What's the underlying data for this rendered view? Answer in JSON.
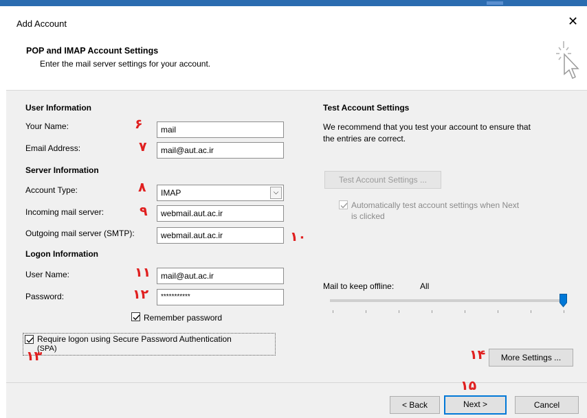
{
  "window": {
    "title": "Add Account",
    "close_glyph": "✕"
  },
  "header": {
    "title": "POP and IMAP Account Settings",
    "subtitle": "Enter the mail server settings for your account."
  },
  "user_info": {
    "heading": "User Information",
    "name_label": "Your Name:",
    "name_value": "mail",
    "email_label": "Email Address:",
    "email_value": "mail@aut.ac.ir"
  },
  "server_info": {
    "heading": "Server Information",
    "account_type_label": "Account Type:",
    "account_type_value": "IMAP",
    "incoming_label": "Incoming mail server:",
    "incoming_value": "webmail.aut.ac.ir",
    "outgoing_label": "Outgoing mail server (SMTP):",
    "outgoing_value": "webmail.aut.ac.ir"
  },
  "logon_info": {
    "heading": "Logon Information",
    "username_label": "User Name:",
    "username_value": "mail@aut.ac.ir",
    "password_label": "Password:",
    "password_value": "***********",
    "remember_label": "Remember password",
    "remember_checked": true,
    "spa_label_line1": "Require logon using Secure Password Authentication",
    "spa_label_line2": "(SPA)",
    "spa_checked": true
  },
  "test_settings": {
    "heading": "Test Account Settings",
    "description_line1": "We recommend that you test your account to ensure that",
    "description_line2": "the entries are correct.",
    "test_button": "Test Account Settings ...",
    "auto_test_line1": "Automatically test account settings when Next",
    "auto_test_line2": "is clicked",
    "auto_test_checked": true
  },
  "offline": {
    "label": "Mail to keep offline:",
    "value": "All",
    "slider_level": 1.0
  },
  "annotations": {
    "n6": "۶",
    "n7": "۷",
    "n8": "۸",
    "n9": "۹",
    "n10": "۱۰",
    "n11": "۱۱",
    "n12": "۱۲",
    "n13": "۱۳",
    "n14": "۱۴",
    "n15": "۱۵"
  },
  "buttons": {
    "more_settings": "More Settings ...",
    "back": "< Back",
    "next": "Next >",
    "cancel": "Cancel"
  },
  "colors": {
    "accent": "#0078d7",
    "annotation": "#e02020"
  }
}
